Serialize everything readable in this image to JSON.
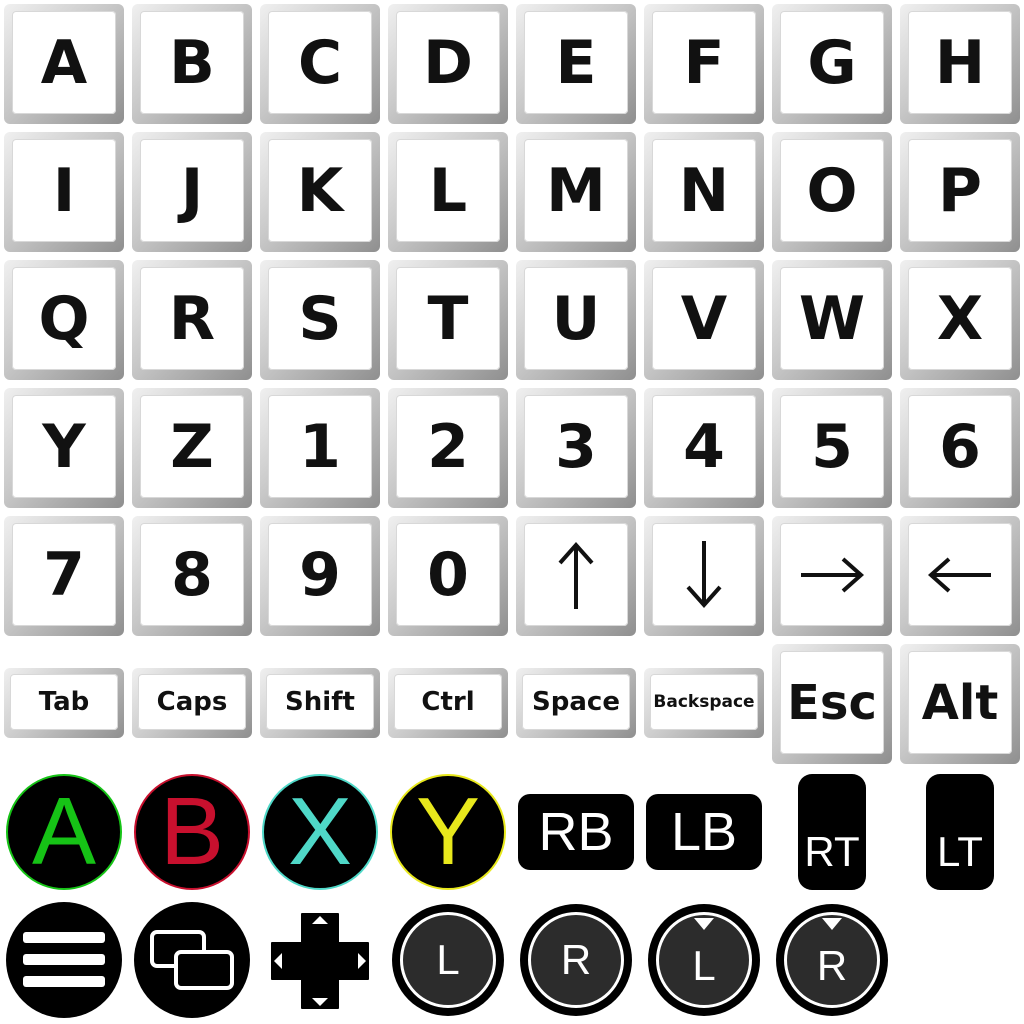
{
  "keys": {
    "letters": [
      "A",
      "B",
      "C",
      "D",
      "E",
      "F",
      "G",
      "H",
      "I",
      "J",
      "K",
      "L",
      "M",
      "N",
      "O",
      "P",
      "Q",
      "R",
      "S",
      "T",
      "U",
      "V",
      "W",
      "X",
      "Y",
      "Z"
    ],
    "digits": [
      "1",
      "2",
      "3",
      "4",
      "5",
      "6",
      "7",
      "8",
      "9",
      "0"
    ],
    "arrows": {
      "up": "up-arrow-icon",
      "down": "down-arrow-icon",
      "right": "right-arrow-icon",
      "left": "left-arrow-icon"
    },
    "modifiers": {
      "tab": "Tab",
      "caps": "Caps",
      "shift": "Shift",
      "ctrl": "Ctrl",
      "space": "Space",
      "backspace": "Backspace",
      "esc": "Esc",
      "alt": "Alt"
    }
  },
  "gamepad": {
    "face_buttons": {
      "a": {
        "label": "A",
        "color": "#16c316",
        "ring": "#16c316"
      },
      "b": {
        "label": "B",
        "color": "#c8102e",
        "ring": "#c8102e"
      },
      "x": {
        "label": "X",
        "color": "#4fd8c8",
        "ring": "#4fd8c8"
      },
      "y": {
        "label": "Y",
        "color": "#e8e81c",
        "ring": "#e8e81c"
      }
    },
    "bumpers": {
      "rb": "RB",
      "lb": "LB"
    },
    "triggers": {
      "rt": "RT",
      "lt": "LT"
    },
    "system": {
      "menu": "menu-icon",
      "view": "view-icon",
      "dpad": "dpad-icon"
    },
    "sticks": {
      "l": "L",
      "r": "R",
      "l_click": "L",
      "r_click": "R"
    }
  }
}
